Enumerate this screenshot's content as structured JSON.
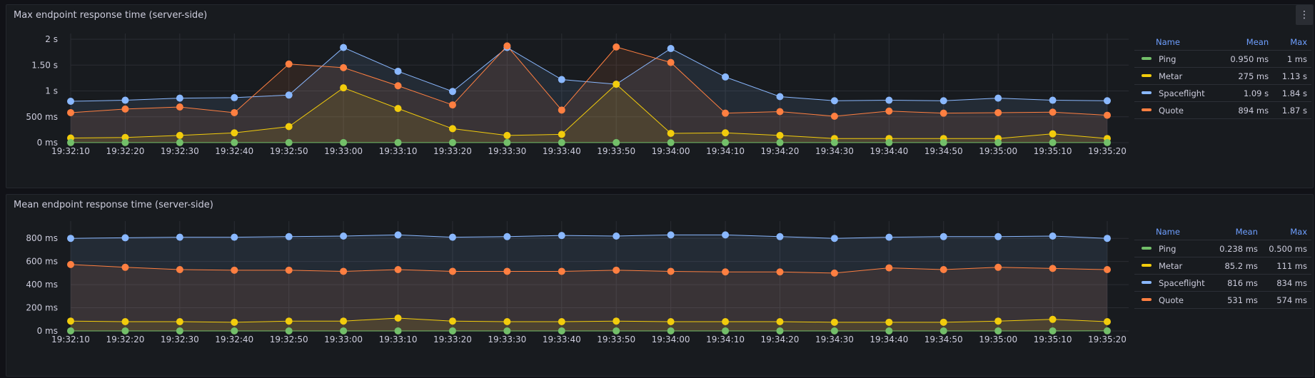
{
  "panels": [
    {
      "title": "Max endpoint response time (server-side)",
      "legend": {
        "headers": {
          "name": "Name",
          "mean": "Mean",
          "max": "Max"
        },
        "rows": [
          {
            "name": "Ping",
            "mean": "0.950 ms",
            "max": "1 ms",
            "color": "#73bf69"
          },
          {
            "name": "Metar",
            "mean": "275 ms",
            "max": "1.13 s",
            "color": "#f2cc0c"
          },
          {
            "name": "Spaceflight",
            "mean": "1.09 s",
            "max": "1.84 s",
            "color": "#8ab8ff"
          },
          {
            "name": "Quote",
            "mean": "894 ms",
            "max": "1.87 s",
            "color": "#ff7f41"
          }
        ]
      }
    },
    {
      "title": "Mean endpoint response time (server-side)",
      "legend": {
        "headers": {
          "name": "Name",
          "mean": "Mean",
          "max": "Max"
        },
        "rows": [
          {
            "name": "Ping",
            "mean": "0.238 ms",
            "max": "0.500 ms",
            "color": "#73bf69"
          },
          {
            "name": "Metar",
            "mean": "85.2 ms",
            "max": "111 ms",
            "color": "#f2cc0c"
          },
          {
            "name": "Spaceflight",
            "mean": "816 ms",
            "max": "834 ms",
            "color": "#8ab8ff"
          },
          {
            "name": "Quote",
            "mean": "531 ms",
            "max": "574 ms",
            "color": "#ff7f41"
          }
        ]
      }
    }
  ],
  "chart_data": [
    {
      "type": "line",
      "title": "Max endpoint response time (server-side)",
      "x": [
        "19:32:10",
        "19:32:20",
        "19:32:30",
        "19:32:40",
        "19:32:50",
        "19:33:00",
        "19:33:10",
        "19:33:20",
        "19:33:30",
        "19:33:40",
        "19:33:50",
        "19:34:00",
        "19:34:10",
        "19:34:20",
        "19:34:30",
        "19:34:40",
        "19:34:50",
        "19:35:00",
        "19:35:10",
        "19:35:20"
      ],
      "y_unit": "ms",
      "ylim": [
        0,
        2000
      ],
      "y_ticks": [
        0,
        500,
        1000,
        1500,
        2000
      ],
      "y_tick_labels": [
        "0 ms",
        "500 ms",
        "1 s",
        "1.50 s",
        "2 s"
      ],
      "series": [
        {
          "name": "Spaceflight",
          "color": "#8ab8ff",
          "values": [
            800,
            820,
            860,
            870,
            920,
            1840,
            1380,
            990,
            1840,
            1220,
            1130,
            1820,
            1270,
            890,
            810,
            820,
            810,
            860,
            820,
            810
          ]
        },
        {
          "name": "Quote",
          "color": "#ff7f41",
          "values": [
            580,
            650,
            690,
            580,
            1520,
            1450,
            1100,
            730,
            1870,
            630,
            1850,
            1550,
            570,
            600,
            510,
            610,
            570,
            580,
            590,
            530
          ]
        },
        {
          "name": "Metar",
          "color": "#f2cc0c",
          "values": [
            90,
            100,
            140,
            190,
            310,
            1060,
            660,
            270,
            140,
            160,
            1130,
            180,
            190,
            140,
            80,
            80,
            80,
            80,
            170,
            80
          ]
        },
        {
          "name": "Ping",
          "color": "#73bf69",
          "values": [
            1,
            1,
            1,
            1,
            1,
            1,
            1,
            1,
            1,
            1,
            1,
            1,
            1,
            1,
            1,
            1,
            1,
            1,
            1,
            1
          ]
        }
      ],
      "grid": true,
      "legend_position": "right"
    },
    {
      "type": "line",
      "title": "Mean endpoint response time (server-side)",
      "x": [
        "19:32:10",
        "19:32:20",
        "19:32:30",
        "19:32:40",
        "19:32:50",
        "19:33:00",
        "19:33:10",
        "19:33:20",
        "19:33:30",
        "19:33:40",
        "19:33:50",
        "19:34:00",
        "19:34:10",
        "19:34:20",
        "19:34:30",
        "19:34:40",
        "19:34:50",
        "19:35:00",
        "19:35:10",
        "19:35:20"
      ],
      "y_unit": "ms",
      "ylim": [
        0,
        900
      ],
      "y_ticks": [
        0,
        200,
        400,
        600,
        800
      ],
      "y_tick_labels": [
        "0 ms",
        "200 ms",
        "400 ms",
        "600 ms",
        "800 ms"
      ],
      "series": [
        {
          "name": "Spaceflight",
          "color": "#8ab8ff",
          "values": [
            800,
            805,
            810,
            810,
            815,
            820,
            830,
            810,
            815,
            825,
            820,
            830,
            830,
            815,
            800,
            810,
            815,
            815,
            820,
            800
          ]
        },
        {
          "name": "Quote",
          "color": "#ff7f41",
          "values": [
            574,
            550,
            530,
            525,
            525,
            515,
            530,
            515,
            515,
            515,
            525,
            515,
            510,
            510,
            500,
            545,
            530,
            550,
            540,
            530
          ]
        },
        {
          "name": "Metar",
          "color": "#f2cc0c",
          "values": [
            85,
            80,
            80,
            75,
            85,
            85,
            111,
            85,
            80,
            80,
            85,
            80,
            80,
            80,
            75,
            75,
            75,
            85,
            100,
            80
          ]
        },
        {
          "name": "Ping",
          "color": "#73bf69",
          "values": [
            0.3,
            0.3,
            0.3,
            0.3,
            0.3,
            0.3,
            0.3,
            0.3,
            0.3,
            0.3,
            0.3,
            0.3,
            0.3,
            0.3,
            0.3,
            0.3,
            0.3,
            0.3,
            0.3,
            0.5
          ]
        }
      ],
      "grid": true,
      "legend_position": "right"
    }
  ]
}
